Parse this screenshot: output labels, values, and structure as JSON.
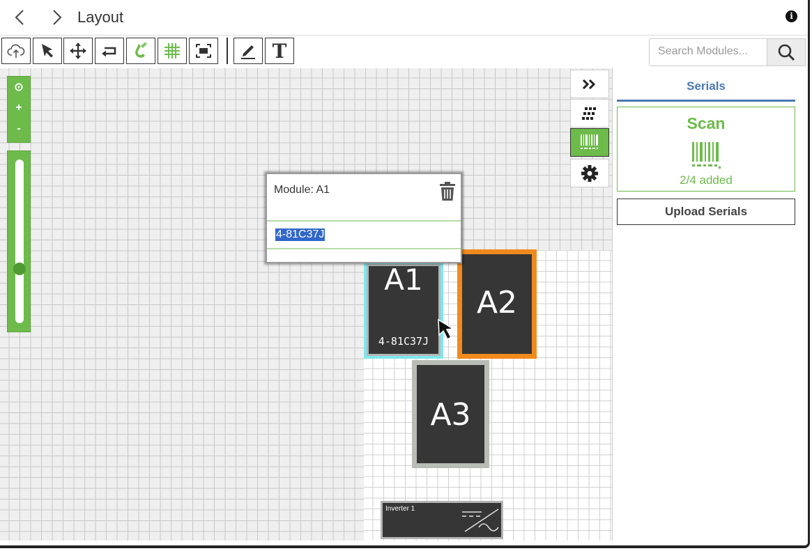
{
  "window": {
    "title": "Layout",
    "back_icon": "chevron-left-icon",
    "forward_icon": "chevron-right-icon",
    "info_icon": "info-icon",
    "info_glyph": "i"
  },
  "toolbar": {
    "tools": [
      "cloud-upload-icon",
      "select-arrow-icon",
      "move-icon",
      "rotate-icon",
      "magnet-icon",
      "grid-icon",
      "fit-screen-icon",
      "pencil-icon",
      "text-icon"
    ],
    "text_tool_glyph": "T",
    "search_placeholder": "Search Modules..."
  },
  "zoom": {
    "center_glyph": "⊙",
    "plus": "+",
    "minus": "-",
    "level": 0.68
  },
  "modules": [
    {
      "label": "A1",
      "serial": "4-81C37J",
      "state": "selected"
    },
    {
      "label": "A2",
      "serial": "",
      "state": "highlighted"
    },
    {
      "label": "A3",
      "serial": "",
      "state": "normal"
    }
  ],
  "inverter": {
    "label": "Inverter 1"
  },
  "popup": {
    "title": "Module: A1",
    "serial_value": "4-81C37J"
  },
  "side_tabs": [
    "collapse-icon",
    "grid-dots-icon",
    "barcode-icon",
    "settings-icon"
  ],
  "panel": {
    "tab_label": "Serials",
    "scan_title": "Scan",
    "scan_count": "2/4 added",
    "upload_label": "Upload Serials"
  },
  "colors": {
    "accent_green": "#6dbb4b",
    "accent_blue": "#4a78b3",
    "selected_cyan": "#7ee8ee",
    "highlight_orange": "#f08a1c",
    "module_dark": "#363636"
  }
}
